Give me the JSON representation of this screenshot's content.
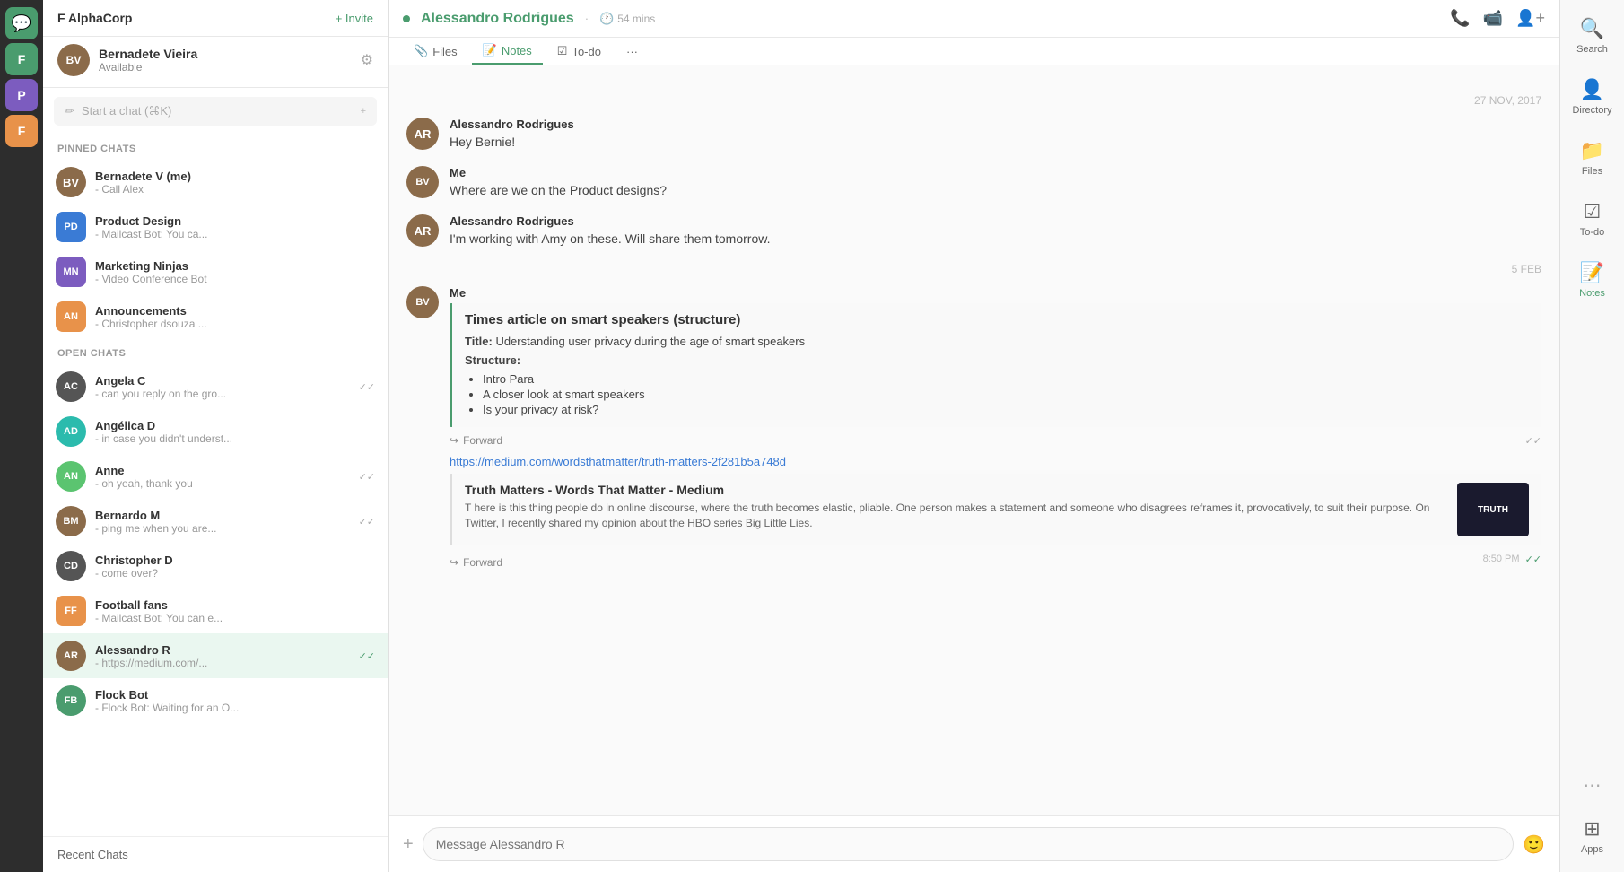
{
  "org": {
    "name": "F AlphaCorp",
    "invite_label": "+ Invite"
  },
  "current_user": {
    "name": "Bernadete Vieira",
    "status": "Available",
    "initials": "BV"
  },
  "search": {
    "placeholder": "Start a chat (⌘K)"
  },
  "sections": {
    "pinned": "PINNED CHATS",
    "open": "OPEN CHATS"
  },
  "pinned_chats": [
    {
      "id": 1,
      "name": "Bernadete V (me)",
      "preview": "- Call Alex",
      "color": "bg-brown",
      "initials": "BV"
    },
    {
      "id": 2,
      "name": "Product Design",
      "preview": "- Mailcast Bot: You ca...",
      "color": "bg-blue",
      "initials": "PD",
      "is_group": true
    },
    {
      "id": 3,
      "name": "Marketing Ninjas",
      "preview": "- Video Conference Bot",
      "color": "bg-purple",
      "initials": "MN",
      "is_group": true
    },
    {
      "id": 4,
      "name": "Announcements",
      "preview": "- Christopher dsouza ...",
      "color": "bg-orange",
      "initials": "AN",
      "is_group": true
    }
  ],
  "open_chats": [
    {
      "id": 5,
      "name": "Angela C",
      "preview": "- can you reply on the gro...",
      "color": "bg-dark",
      "initials": "AC",
      "has_check": true
    },
    {
      "id": 6,
      "name": "Angélica D",
      "preview": "- in case you didn't underst...",
      "color": "bg-teal",
      "initials": "AD"
    },
    {
      "id": 7,
      "name": "Anne",
      "preview": "- oh yeah, thank you",
      "color": "bg-light-green",
      "initials": "AN",
      "has_check": true
    },
    {
      "id": 8,
      "name": "Bernardo M",
      "preview": "- ping me when you are...",
      "color": "bg-brown",
      "initials": "BM",
      "has_check": true
    },
    {
      "id": 9,
      "name": "Christopher D",
      "preview": "- come over?",
      "color": "bg-dark",
      "initials": "CD"
    },
    {
      "id": 10,
      "name": "Football fans",
      "preview": "- Mailcast Bot: You can e...",
      "color": "bg-orange",
      "initials": "FF",
      "is_group": true
    },
    {
      "id": 11,
      "name": "Alessandro R",
      "preview": "- https://medium.com/...",
      "color": "bg-brown",
      "initials": "AR",
      "has_check": true,
      "active": true
    },
    {
      "id": 12,
      "name": "Flock Bot",
      "preview": "- Flock Bot: Waiting for an O...",
      "color": "bg-green",
      "initials": "FB"
    }
  ],
  "recent_chats_label": "Recent Chats",
  "chat_header": {
    "name": "Alessandro Rodrigues",
    "status": "54 mins",
    "tabs": [
      {
        "id": "files",
        "label": "Files",
        "icon": "📎",
        "active": false
      },
      {
        "id": "notes",
        "label": "Notes",
        "icon": "📝",
        "active": true
      },
      {
        "id": "todo",
        "label": "To-do",
        "icon": "☑",
        "active": false
      },
      {
        "id": "more",
        "label": "...",
        "active": false
      }
    ]
  },
  "messages": [
    {
      "date_separator": "27 NOV, 2017",
      "items": [
        {
          "id": 1,
          "sender": "Alessandro Rodrigues",
          "text": "Hey Bernie!",
          "initials": "AR",
          "color": "bg-brown"
        },
        {
          "id": 2,
          "sender": "Me",
          "text": "Where are we on the Product designs?",
          "initials": "BV",
          "color": "bg-brown"
        },
        {
          "id": 3,
          "sender": "Alessandro Rodrigues",
          "text": "I'm working with Amy on these. Will share them tomorrow.",
          "initials": "AR",
          "color": "bg-brown"
        }
      ]
    },
    {
      "date_separator": "5 FEB",
      "items": [
        {
          "id": 4,
          "sender": "Me",
          "initials": "BV",
          "color": "bg-brown",
          "has_quote": true,
          "quote_title": "Times article on smart speakers (structure)",
          "quote_field_label": "Title:",
          "quote_field_value": "Uderstanding user privacy during the age of smart speakers",
          "quote_structure_label": "Structure:",
          "quote_list": [
            "Intro Para",
            "A closer look at smart speakers",
            "Is your privacy at risk?"
          ],
          "forward_label": "Forward",
          "has_link": true,
          "link_url": "https://medium.com/wordsthatmatter/truth-matters-2f281b5a748d",
          "link_title": "Truth Matters - Words That Matter - Medium",
          "link_desc": "T here is this thing people do in online discourse, where the truth becomes elastic, pliable. One person makes a statement and someone who disagrees reframes it, provocatively, to suit their purpose. On Twitter, I recently shared my opinion about the HBO series Big Little Lies.",
          "link_forward_label": "Forward",
          "time": "8:50 PM",
          "read": true
        }
      ]
    }
  ],
  "message_input": {
    "placeholder": "Message Alessandro R"
  },
  "right_sidebar": {
    "icons": [
      {
        "id": "search",
        "label": "Search",
        "symbol": "🔍"
      },
      {
        "id": "directory",
        "label": "Directory",
        "symbol": "👤"
      },
      {
        "id": "files",
        "label": "Files",
        "symbol": "📁"
      },
      {
        "id": "todo",
        "label": "To-do",
        "symbol": "☑"
      },
      {
        "id": "notes",
        "label": "Notes",
        "symbol": "📝"
      }
    ],
    "apps_label": "Apps",
    "more_symbol": "⋯"
  },
  "rail_items": [
    {
      "id": "chat",
      "symbol": "💬",
      "active": true
    },
    {
      "id": "F",
      "label": "F",
      "active": false,
      "green": true
    },
    {
      "id": "P",
      "label": "P",
      "active": false,
      "purple": true
    },
    {
      "id": "F2",
      "label": "F",
      "active": false,
      "orange": true
    }
  ]
}
